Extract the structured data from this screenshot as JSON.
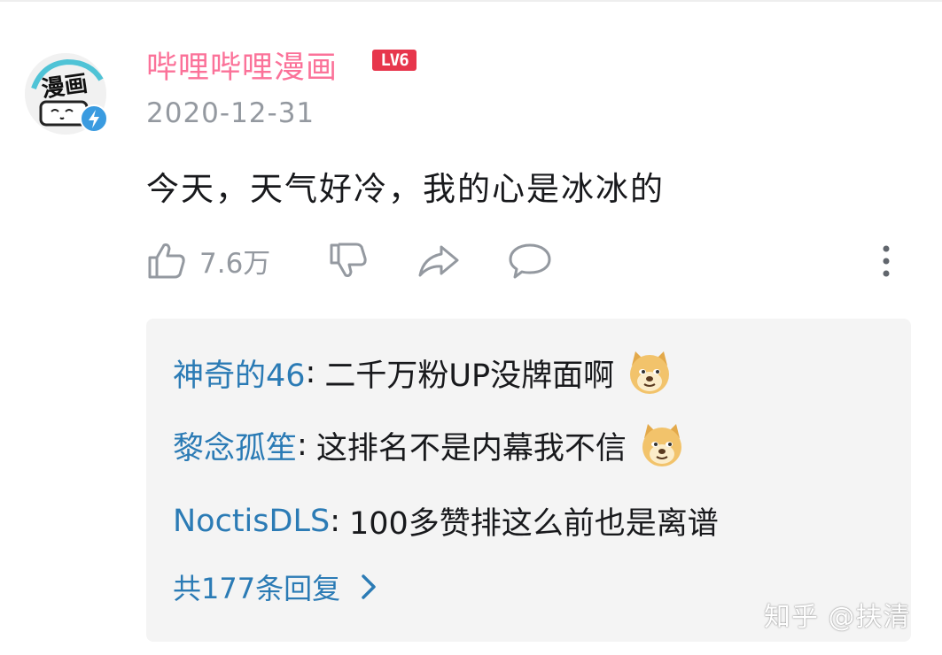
{
  "comment": {
    "author": "哔哩哔哩漫画",
    "level": "LV6",
    "date": "2020-12-31",
    "text": "今天，天气好冷，我的心是冰冰的",
    "likes": "7.6万"
  },
  "avatar": {
    "text": "漫画"
  },
  "icons": {
    "like": "thumb-up-icon",
    "dislike": "thumb-down-icon",
    "share": "share-arrow-icon",
    "reply": "speech-bubble-icon",
    "more": "vertical-dots-icon",
    "verified": "lightning-badge-icon",
    "emoji": "doge-emoji-icon",
    "chevron": "chevron-right-icon"
  },
  "replies": [
    {
      "user": "神奇的46",
      "text": "二千万粉UP没牌面啊",
      "emoji": true
    },
    {
      "user": "黎念孤笙",
      "text": "这排名不是内幕我不信",
      "emoji": true
    },
    {
      "user": "NoctisDLS",
      "text": "100多赞排这么前也是离谱",
      "emoji": false
    }
  ],
  "more_replies_label": "共177条回复",
  "watermark": "知乎 @扶清",
  "colors": {
    "author": "#fb7299",
    "level_badge": "#e7364c",
    "reply_user": "#2b7bb5",
    "secondary_text": "#9499a0",
    "reply_bg": "#f4f4f4",
    "verified_badge": "#3a9be0"
  }
}
